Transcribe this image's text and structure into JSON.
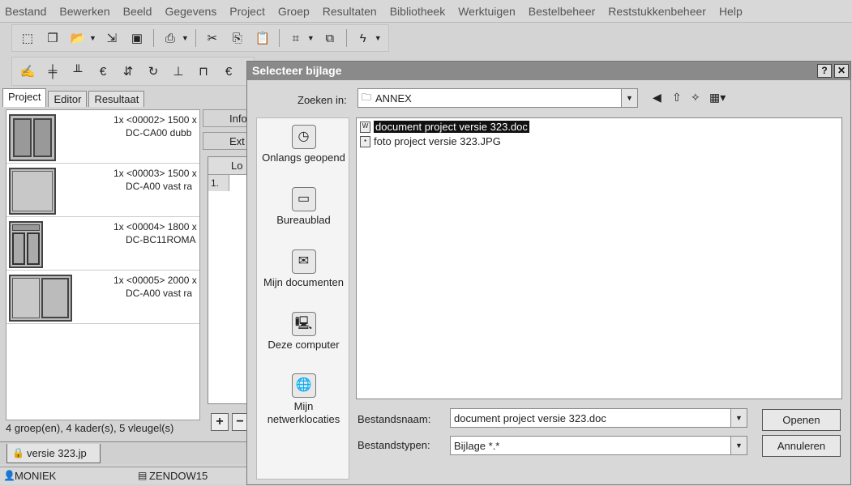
{
  "menu": [
    "Bestand",
    "Bewerken",
    "Beeld",
    "Gegevens",
    "Project",
    "Groep",
    "Resultaten",
    "Bibliotheek",
    "Werktuigen",
    "Bestelbeheer",
    "Reststukkenbeheer",
    "Help"
  ],
  "tabs": [
    "Project",
    "Editor",
    "Resultaat"
  ],
  "project_rows": [
    {
      "line1": "1x <00002> 1500 x",
      "line2": "DC-CA00 dubb"
    },
    {
      "line1": "1x <00003> 1500 x",
      "line2": "DC-A00 vast ra"
    },
    {
      "line1": "1x <00004> 1800 x",
      "line2": "DC-BC11ROMA"
    },
    {
      "line1": "1x <00005> 2000 x",
      "line2": "DC-A00 vast ra"
    }
  ],
  "side_buttons": [
    "Info",
    "Ext"
  ],
  "grid": {
    "col_header": "Lo",
    "row1": "1."
  },
  "summary": "4 groep(en), 4 kader(s), 5 vleugel(s)",
  "doc_tab": "versie 323.jp",
  "status": {
    "user": "MONIEK",
    "db": "ZENDOW15"
  },
  "dialog": {
    "title": "Selecteer bijlage",
    "help_btn": "?",
    "close_btn": "✕",
    "look_in_label": "Zoeken in:",
    "look_in_value": "ANNEX",
    "places": [
      "Onlangs geopend",
      "Bureaublad",
      "Mijn documenten",
      "Deze computer",
      "Mijn netwerklocaties"
    ],
    "files": [
      "document project versie 323.doc",
      "foto project versie 323.JPG"
    ],
    "filename_label": "Bestandsnaam:",
    "filename_value": "document project versie 323.doc",
    "filetype_label": "Bestandstypen:",
    "filetype_value": "Bijlage *.*",
    "open_btn": "Openen",
    "cancel_btn": "Annuleren"
  },
  "colors": {
    "title_bar": "#8a8a8a",
    "selection": "#111111"
  }
}
